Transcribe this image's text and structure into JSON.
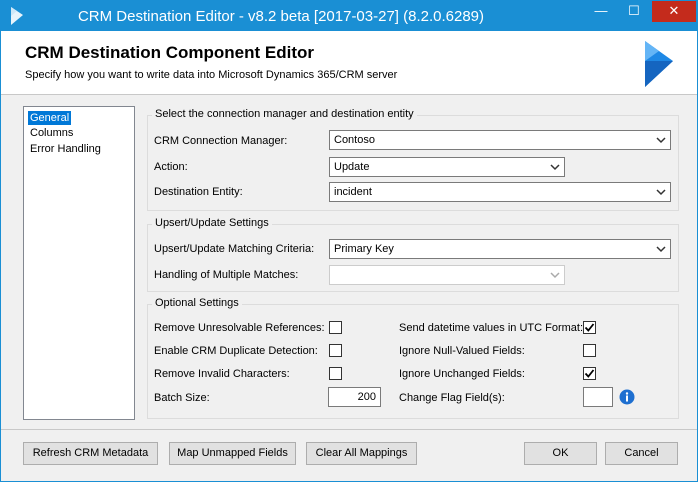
{
  "window": {
    "title": "CRM Destination Editor - v8.2 beta [2017-03-27] (8.2.0.6289)",
    "controls": {
      "minimize": "—",
      "maximize": "☐",
      "close": "✕"
    }
  },
  "header": {
    "title": "CRM Destination Component Editor",
    "subtitle": "Specify how you want to write data into Microsoft Dynamics 365/CRM server"
  },
  "nav": {
    "items": [
      "General",
      "Columns",
      "Error Handling"
    ],
    "selected": "General"
  },
  "connection_group": {
    "title": "Select the connection manager and destination entity",
    "connection_manager_label": "CRM Connection Manager:",
    "connection_manager_value": "Contoso",
    "action_label": "Action:",
    "action_value": "Update",
    "entity_label": "Destination Entity:",
    "entity_value": "incident"
  },
  "upsert_group": {
    "title": "Upsert/Update Settings",
    "matching_label": "Upsert/Update Matching Criteria:",
    "matching_value": "Primary Key",
    "multiple_label": "Handling of Multiple Matches:",
    "multiple_value": ""
  },
  "optional_group": {
    "title": "Optional Settings",
    "remove_unresolvable_label": "Remove Unresolvable References:",
    "remove_unresolvable_checked": false,
    "duplicate_detection_label": "Enable CRM Duplicate Detection:",
    "duplicate_detection_checked": false,
    "remove_invalid_label": "Remove Invalid Characters:",
    "remove_invalid_checked": false,
    "batch_size_label": "Batch Size:",
    "batch_size_value": "200",
    "utc_label": "Send datetime values in UTC Format:",
    "utc_checked": true,
    "ignore_null_label": "Ignore Null-Valued Fields:",
    "ignore_null_checked": false,
    "ignore_unchanged_label": "Ignore Unchanged Fields:",
    "ignore_unchanged_checked": true,
    "change_flag_label": "Change Flag Field(s):",
    "change_flag_value": ""
  },
  "buttons": {
    "refresh": "Refresh CRM Metadata",
    "map_unmapped": "Map Unmapped Fields",
    "clear_mappings": "Clear All Mappings",
    "ok": "OK",
    "cancel": "Cancel"
  },
  "colors": {
    "titlebar": "#1a8fd4",
    "accent": "#0078d7",
    "dynamics_logo": "#1e88e5"
  },
  "icons": {
    "app": "dynamics-logo-icon",
    "dropdown": "chevron-down-icon",
    "check": "checkmark-icon",
    "info": "info-icon"
  }
}
